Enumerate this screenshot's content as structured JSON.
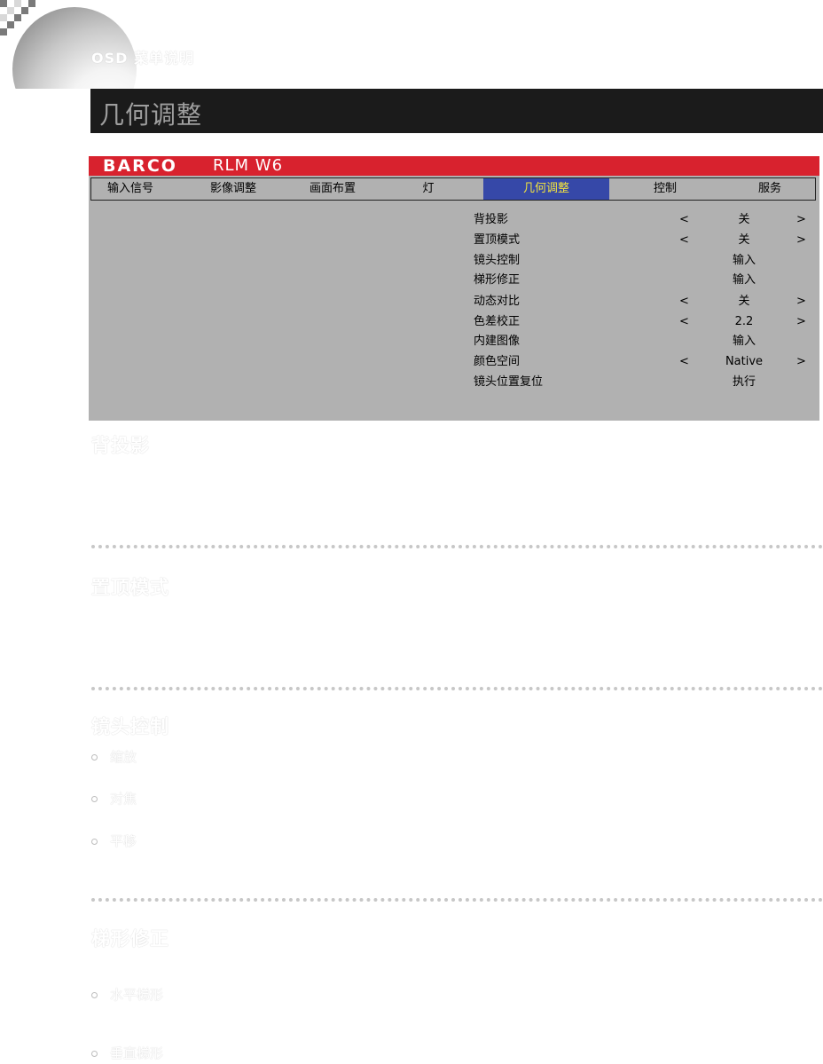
{
  "header": {
    "title": "OSD 菜单说明",
    "section_title": "几何调整"
  },
  "osd": {
    "brand_logo": "BARCO",
    "model": "RLM W6",
    "tabs": [
      {
        "label": "输入信号",
        "active": false
      },
      {
        "label": "影像调整",
        "active": false
      },
      {
        "label": "画面布置",
        "active": false
      },
      {
        "label": "灯",
        "active": false
      },
      {
        "label": "几何调整",
        "active": true
      },
      {
        "label": "控制",
        "active": false
      },
      {
        "label": "服务",
        "active": false
      }
    ],
    "rows": [
      {
        "label": "背投影",
        "left": "<",
        "value": "关",
        "right": ">"
      },
      {
        "label": "置顶模式",
        "left": "<",
        "value": "关",
        "right": ">"
      },
      {
        "label": "镜头控制",
        "left": "",
        "value": "输入",
        "right": ""
      },
      {
        "label": "梯形修正",
        "left": "",
        "value": "输入",
        "right": ""
      },
      {
        "label": "动态对比",
        "left": "<",
        "value": "关",
        "right": ">"
      },
      {
        "label": "色差校正",
        "left": "<",
        "value": "2.2",
        "right": ">"
      },
      {
        "label": "内建图像",
        "left": "",
        "value": "输入",
        "right": ""
      },
      {
        "label": "颜色空间",
        "left": "<",
        "value": "Native",
        "right": ">"
      },
      {
        "label": "镜头位置复位",
        "left": "",
        "value": "执行",
        "right": ""
      }
    ],
    "colors": {
      "brand_bar": "#d8222e",
      "panel": "#b1b1b1",
      "active_tab_bg": "#3648a8",
      "active_tab_text": "#f2e33e"
    }
  },
  "sections": [
    {
      "title": "背投影"
    },
    {
      "title": "置顶模式"
    },
    {
      "title": "镜头控制",
      "bullets": [
        "缩放",
        "对焦",
        "平移"
      ]
    },
    {
      "title": "梯形修正",
      "bullets": [
        "水平梯形",
        "垂直梯形"
      ]
    }
  ]
}
